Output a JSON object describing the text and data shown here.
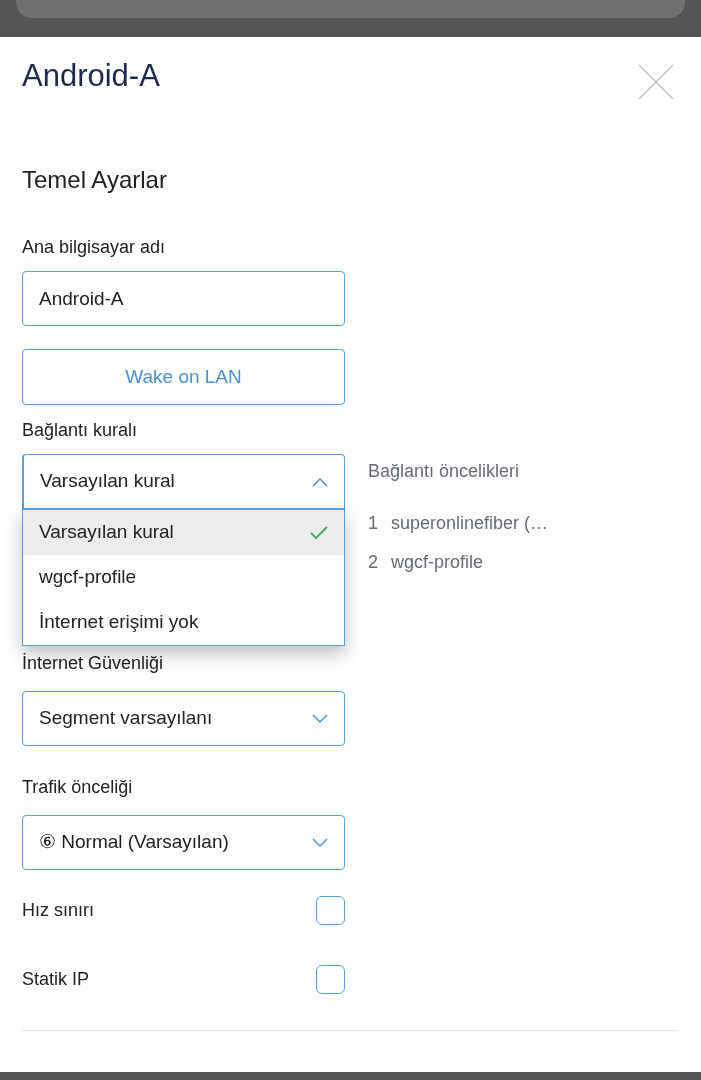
{
  "title": "Android-A",
  "section": "Temel Ayarlar",
  "hostname": {
    "label": "Ana bilgisayar adı",
    "value": "Android-A"
  },
  "wake_button": "Wake on LAN",
  "connection_rule": {
    "label": "Bağlantı kuralı",
    "value": "Varsayılan kural",
    "expanded": true,
    "options": [
      {
        "label": "Varsayılan kural",
        "selected": true
      },
      {
        "label": "wgcf-profile",
        "selected": false
      },
      {
        "label": "İnternet erişimi yok",
        "selected": false
      }
    ]
  },
  "priorities": {
    "title": "Bağlantı öncelikleri",
    "items": [
      {
        "rank": "1",
        "name": "superonlinefiber (…"
      },
      {
        "rank": "2",
        "name": "wgcf-profile"
      }
    ]
  },
  "internet_security": {
    "label": "İnternet Güvenliği",
    "value": "Segment varsayılanı",
    "expanded": false
  },
  "traffic_priority": {
    "label": "Trafik önceliği",
    "value": "⑥ Normal (Varsayılan)",
    "expanded": false
  },
  "toggles": [
    {
      "label": "Hız sınırı",
      "checked": false
    },
    {
      "label": "Statik IP",
      "checked": false
    }
  ]
}
